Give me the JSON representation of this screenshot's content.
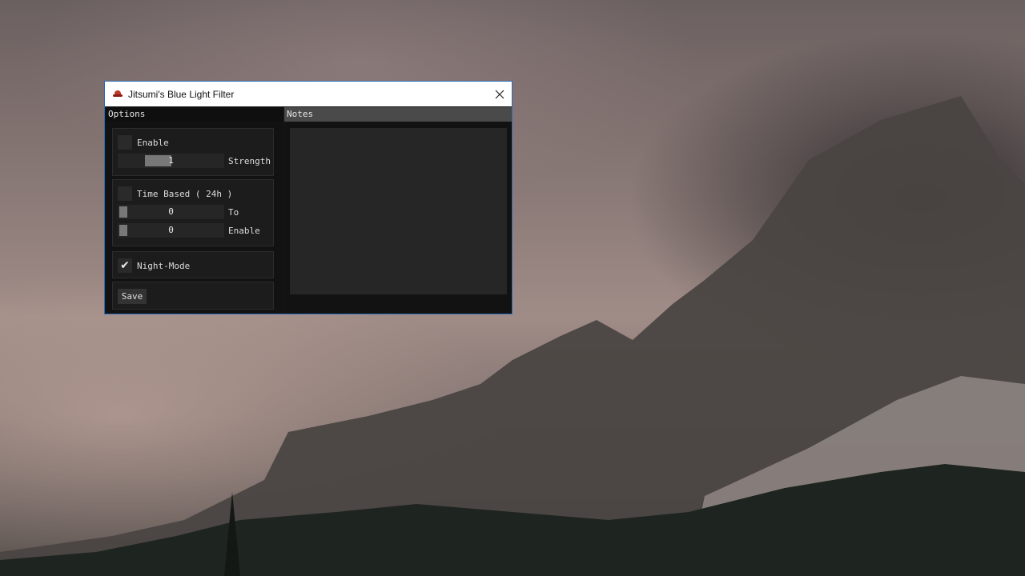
{
  "window": {
    "title": "Jitsumi's Blue Light Filter",
    "close_icon": "close-icon"
  },
  "options": {
    "header": "Options",
    "enable": {
      "label": "Enable",
      "checked": false
    },
    "strength": {
      "label": "Strength",
      "value": "1",
      "level": 0.5
    },
    "time_based": {
      "label": "Time Based ( 24h )",
      "checked": false
    },
    "time_from": {
      "label": "To",
      "value": "0",
      "level": 0.0
    },
    "time_to": {
      "label": "Enable",
      "value": "0",
      "level": 0.0
    },
    "night_mode": {
      "label": "Night-Mode",
      "checked": true,
      "check_glyph": "✔"
    },
    "save_label": "Save"
  },
  "notes": {
    "header": "Notes",
    "text": ""
  }
}
